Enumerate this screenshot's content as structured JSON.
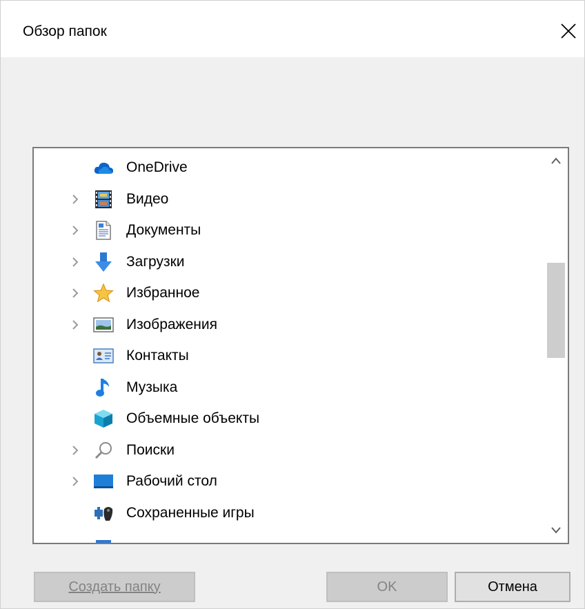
{
  "dialog": {
    "title": "Обзор папок",
    "close_icon": "close-icon"
  },
  "tree": {
    "items": [
      {
        "label": "OneDrive",
        "icon": "onedrive-cloud-icon",
        "expandable": false
      },
      {
        "label": "Видео",
        "icon": "video-folder-icon",
        "expandable": true
      },
      {
        "label": "Документы",
        "icon": "documents-folder-icon",
        "expandable": true
      },
      {
        "label": "Загрузки",
        "icon": "downloads-arrow-icon",
        "expandable": true
      },
      {
        "label": "Избранное",
        "icon": "favorites-star-icon",
        "expandable": true
      },
      {
        "label": "Изображения",
        "icon": "pictures-folder-icon",
        "expandable": true
      },
      {
        "label": "Контакты",
        "icon": "contacts-card-icon",
        "expandable": false
      },
      {
        "label": "Музыка",
        "icon": "music-note-icon",
        "expandable": false
      },
      {
        "label": "Объемные объекты",
        "icon": "3d-objects-cube-icon",
        "expandable": false
      },
      {
        "label": "Поиски",
        "icon": "searches-magnifier-icon",
        "expandable": true
      },
      {
        "label": "Рабочий стол",
        "icon": "desktop-folder-icon",
        "expandable": true
      },
      {
        "label": "Сохраненные игры",
        "icon": "saved-games-icon",
        "expandable": false
      },
      {
        "label": "",
        "icon": "links-folder-icon",
        "expandable": false
      }
    ]
  },
  "buttons": {
    "new_folder": "Создать папку",
    "ok": "OK",
    "cancel": "Отмена"
  },
  "colors": {
    "background": "#f0f0f0",
    "accent_blue": "#0078d7",
    "disabled_text": "#838383"
  }
}
